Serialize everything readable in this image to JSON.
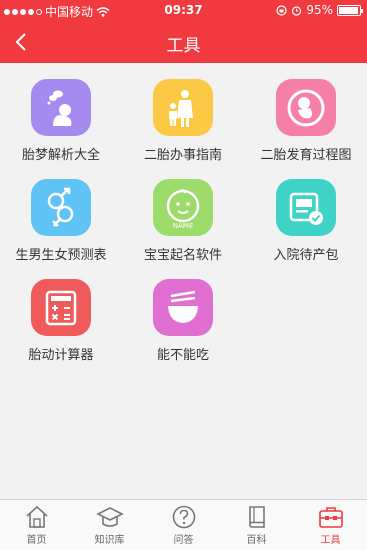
{
  "status_bar": {
    "carrier": "中国移动",
    "time": "09:37",
    "battery": "95%",
    "battery_level": 0.95
  },
  "nav": {
    "title": "工具",
    "back_icon": "chevron-left-icon"
  },
  "tools": [
    {
      "label": "胎梦解析大全",
      "icon": "dreaming-baby-icon",
      "color": "#a58bf0"
    },
    {
      "label": "二胎办事指南",
      "icon": "mother-child-icon",
      "color": "#fcc945"
    },
    {
      "label": "二胎发育过程图",
      "icon": "fetus-womb-icon",
      "color": "#f57fa6"
    },
    {
      "label": "生男生女预测表",
      "icon": "gender-symbols-icon",
      "color": "#5fc3f5"
    },
    {
      "label": "宝宝起名软件",
      "icon": "baby-face-name-icon",
      "color": "#9ddb6a"
    },
    {
      "label": "入院待产包",
      "icon": "checklist-bag-icon",
      "color": "#3fd2c7"
    },
    {
      "label": "胎动计算器",
      "icon": "calculator-icon",
      "color": "#ef5b5b"
    },
    {
      "label": "能不能吃",
      "icon": "bowl-chopsticks-icon",
      "color": "#df6fd0"
    }
  ],
  "tabbar": {
    "items": [
      {
        "label": "首页",
        "icon": "home-icon"
      },
      {
        "label": "知识库",
        "icon": "graduation-cap-icon"
      },
      {
        "label": "问答",
        "icon": "question-icon"
      },
      {
        "label": "百科",
        "icon": "book-icon"
      },
      {
        "label": "工具",
        "icon": "toolbox-icon"
      }
    ],
    "active": "工具",
    "active_color": "#f03a3f"
  }
}
